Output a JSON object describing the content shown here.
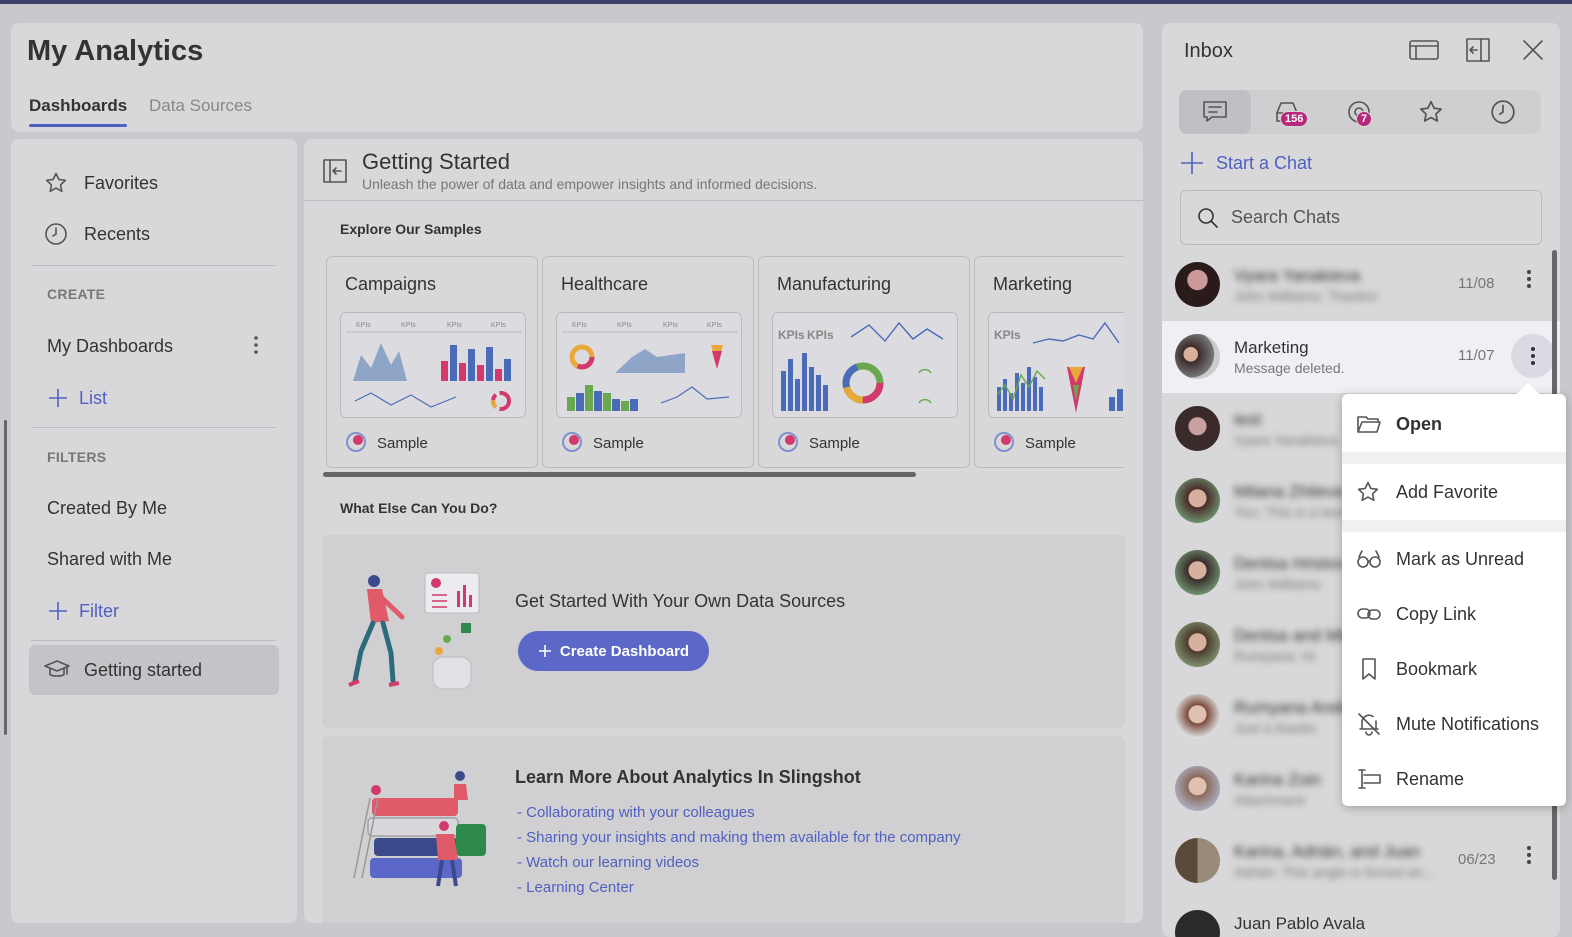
{
  "app": {
    "title": "My Analytics",
    "tabs": [
      "Dashboards",
      "Data Sources"
    ],
    "active_tab": "Dashboards"
  },
  "sidebar": {
    "favorites": "Favorites",
    "recents": "Recents",
    "create_header": "CREATE",
    "my_dashboards": "My Dashboards",
    "list_link": "List",
    "filters_header": "FILTERS",
    "created_by_me": "Created By Me",
    "shared_with_me": "Shared with Me",
    "filter_link": "Filter",
    "getting_started": "Getting started"
  },
  "main": {
    "title": "Getting Started",
    "subtitle": "Unleash the power of data and empower insights and informed decisions.",
    "explore_header": "Explore Our Samples",
    "samples": [
      {
        "name": "Campaigns",
        "tag": "Sample"
      },
      {
        "name": "Healthcare",
        "tag": "Sample"
      },
      {
        "name": "Manufacturing",
        "tag": "Sample"
      },
      {
        "name": "Marketing",
        "tag": "Sample"
      }
    ],
    "kpi_label": "KPIs",
    "what_else_header": "What Else Can You Do?",
    "own_data": {
      "title": "Get Started With Your Own Data Sources",
      "button": "Create Dashboard"
    },
    "learn": {
      "title": "Learn More About Analytics In Slingshot",
      "links": [
        "- Collaborating with your colleagues",
        "- Sharing your insights and making them available for the company",
        "- Watch our learning videos",
        "- Learning Center"
      ]
    }
  },
  "inbox": {
    "title": "Inbox",
    "tabs": [
      {
        "icon": "chat-icon",
        "badge": ""
      },
      {
        "icon": "inbox-icon",
        "badge": "156"
      },
      {
        "icon": "mention-icon",
        "badge": "7"
      },
      {
        "icon": "star-icon",
        "badge": ""
      },
      {
        "icon": "clock-icon",
        "badge": ""
      }
    ],
    "start_chat": "Start a Chat",
    "search_placeholder": "Search Chats",
    "chats": [
      {
        "name": "Vyara Yanakieva",
        "preview": "John Williams: Thanks!",
        "date": "11/08"
      },
      {
        "name": "Marketing",
        "preview": "Message deleted.",
        "date": "11/07"
      },
      {
        "name": "test",
        "preview": "Vyara Yanakieva",
        "date": ""
      },
      {
        "name": "Milana Zhileva",
        "preview": "You: This is a test",
        "date": ""
      },
      {
        "name": "Dentsa Hristov",
        "preview": "John Williams",
        "date": ""
      },
      {
        "name": "Dentsa and Milana",
        "preview": "Rumyana: Hi",
        "date": ""
      },
      {
        "name": "Rumyana Andreeva",
        "preview": "Just a thanks",
        "date": ""
      },
      {
        "name": "Karina Zoin",
        "preview": "Attachment",
        "date": ""
      },
      {
        "name": "Karina, Adrián, and Juan",
        "preview": "Adrián: This angle is forced an...",
        "date": "06/23"
      },
      {
        "name": "Juan Pablo Avala",
        "preview": "",
        "date": ""
      }
    ]
  },
  "context_menu": {
    "items": [
      "Open",
      "Add Favorite",
      "Mark as Unread",
      "Copy Link",
      "Bookmark",
      "Mute Notifications",
      "Rename"
    ]
  },
  "colors": {
    "accent": "#5060c0",
    "badge": "#b8287a",
    "button": "#5b68c8"
  }
}
